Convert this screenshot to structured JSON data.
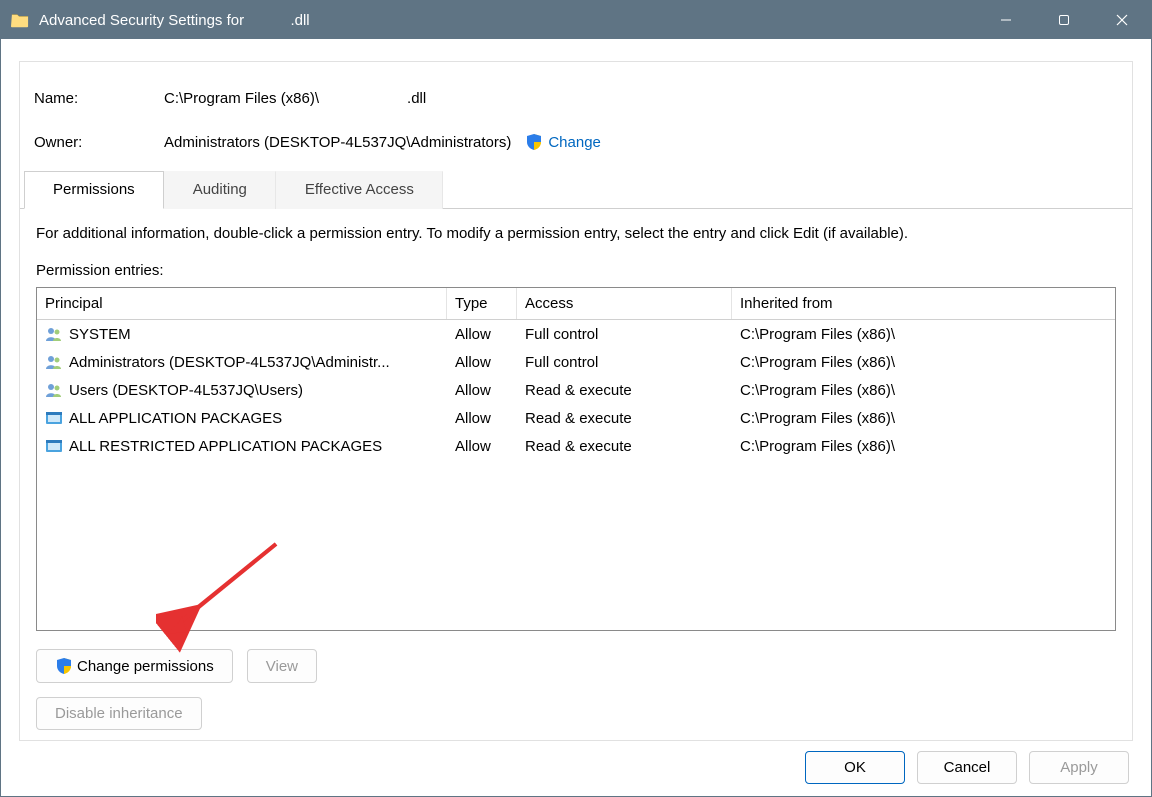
{
  "window": {
    "title_prefix": "Advanced Security Settings for",
    "title_suffix": ".dll"
  },
  "meta": {
    "name_label": "Name:",
    "name_value_prefix": "C:\\Program Files (x86)\\",
    "name_value_suffix": ".dll",
    "owner_label": "Owner:",
    "owner_value": "Administrators (DESKTOP-4L537JQ\\Administrators)",
    "change_link": "Change"
  },
  "tabs": {
    "permissions": "Permissions",
    "auditing": "Auditing",
    "effective": "Effective Access"
  },
  "body": {
    "info": "For additional information, double-click a permission entry. To modify a permission entry, select the entry and click Edit (if available).",
    "entries_label": "Permission entries:"
  },
  "grid": {
    "headers": {
      "principal": "Principal",
      "type": "Type",
      "access": "Access",
      "inherited": "Inherited from"
    },
    "rows": [
      {
        "icon": "users",
        "principal": "SYSTEM",
        "type": "Allow",
        "access": "Full control",
        "inherited": "C:\\Program Files (x86)\\"
      },
      {
        "icon": "users",
        "principal": "Administrators (DESKTOP-4L537JQ\\Administr...",
        "type": "Allow",
        "access": "Full control",
        "inherited": "C:\\Program Files (x86)\\"
      },
      {
        "icon": "users",
        "principal": "Users (DESKTOP-4L537JQ\\Users)",
        "type": "Allow",
        "access": "Read & execute",
        "inherited": "C:\\Program Files (x86)\\"
      },
      {
        "icon": "pkg",
        "principal": "ALL APPLICATION PACKAGES",
        "type": "Allow",
        "access": "Read & execute",
        "inherited": "C:\\Program Files (x86)\\"
      },
      {
        "icon": "pkg",
        "principal": "ALL RESTRICTED APPLICATION PACKAGES",
        "type": "Allow",
        "access": "Read & execute",
        "inherited": "C:\\Program Files (x86)\\"
      }
    ]
  },
  "buttons": {
    "change_perms": "Change permissions",
    "view": "View",
    "disable_inherit": "Disable inheritance",
    "ok": "OK",
    "cancel": "Cancel",
    "apply": "Apply"
  }
}
